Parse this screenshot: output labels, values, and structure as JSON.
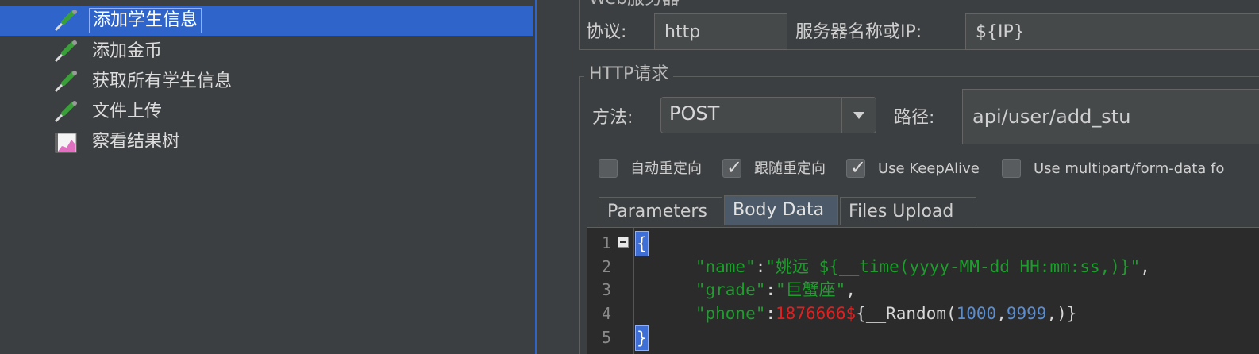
{
  "tree": {
    "items": [
      {
        "label": "添加学生信息",
        "selected": true,
        "icon": "pipette-icon"
      },
      {
        "label": "添加金币",
        "selected": false,
        "icon": "pipette-icon"
      },
      {
        "label": "获取所有学生信息",
        "selected": false,
        "icon": "pipette-icon"
      },
      {
        "label": "文件上传",
        "selected": false,
        "icon": "pipette-icon"
      },
      {
        "label": "察看结果树",
        "selected": false,
        "icon": "chart-icon"
      }
    ]
  },
  "web_server": {
    "title": "Web服务器",
    "protocol_label": "协议:",
    "protocol_value": "http",
    "server_label": "服务器名称或IP:",
    "server_value": "${IP}"
  },
  "http_request": {
    "title": "HTTP请求",
    "method_label": "方法:",
    "method_value": "POST",
    "path_label": "路径:",
    "path_value": "api/user/add_stu",
    "checkboxes": [
      {
        "label": "自动重定向",
        "checked": false
      },
      {
        "label": "跟随重定向",
        "checked": true
      },
      {
        "label": "Use KeepAlive",
        "checked": true
      },
      {
        "label": "Use multipart/form-data fo",
        "checked": false
      }
    ],
    "tabs": [
      {
        "label": "Parameters",
        "active": false
      },
      {
        "label": "Body Data",
        "active": true
      },
      {
        "label": "Files Upload",
        "active": false
      }
    ]
  },
  "editor": {
    "line_numbers": [
      "1",
      "2",
      "3",
      "4",
      "5"
    ],
    "lines": {
      "l1": "{",
      "l2_key": "\"name\"",
      "l2_colon": ":",
      "l2_val": "\"姚远 ${__time(yyyy-MM-dd HH:mm:ss,)}\"",
      "l2_comma": ",",
      "l3_key": "\"grade\"",
      "l3_colon": ":",
      "l3_val": "\"巨蟹座\"",
      "l3_comma": ",",
      "l4_key": "\"phone\"",
      "l4_colon": ":",
      "l4_red": "1876666$",
      "l4_fn": "{__Random(",
      "l4_n1": "1000",
      "l4_c": ",",
      "l4_n2": "9999",
      "l4_end": ",)}",
      "l5": "}"
    }
  }
}
